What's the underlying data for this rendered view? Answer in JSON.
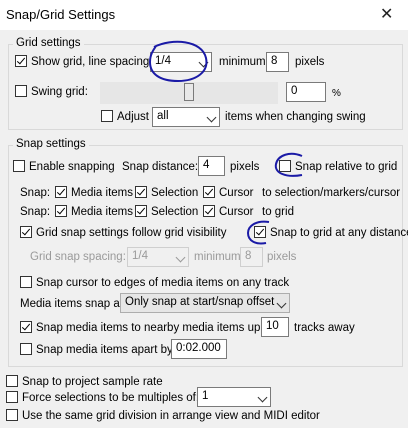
{
  "window": {
    "title": "Snap/Grid Settings",
    "close_glyph": "✕"
  },
  "grid": {
    "label": "Grid settings",
    "show_grid_label": "Show grid, line spacing:",
    "show_grid_checked": true,
    "line_spacing": "1/4",
    "minimum_label": "minimum:",
    "minimum_value": "8",
    "pixels_label": "pixels",
    "swing_label": "Swing grid:",
    "swing_checked": false,
    "swing_value": "0",
    "swing_level": 0.5,
    "percent_label": "%",
    "adjust_label": "Adjust",
    "adjust_checked": false,
    "adjust_value": "all",
    "adjust_suffix": "items when changing swing"
  },
  "snap": {
    "label": "Snap settings",
    "enable_label": "Enable snapping",
    "enable_checked": false,
    "distance_label": "Snap distance:",
    "distance_value": "4",
    "distance_unit": "pixels",
    "relative_label": "Snap relative to grid",
    "relative_checked": false,
    "row1_label": "Snap:",
    "row2_label": "Snap:",
    "media_items": "Media items",
    "selection": "Selection",
    "cursor": "Cursor",
    "row1_suffix": "to selection/markers/cursor",
    "row2_suffix": "to grid",
    "follow_label": "Grid snap settings follow grid visibility",
    "follow_checked": true,
    "any_distance_label": "Snap to grid at any distance",
    "any_distance_checked": true,
    "grid_spacing_label": "Grid snap spacing:",
    "grid_spacing_value": "1/4",
    "grid_min_label": "minimum:",
    "grid_min_value": "8",
    "grid_min_unit": "pixels",
    "cursor_edges_label": "Snap cursor to edges of media items on any track",
    "cursor_edges_checked": false,
    "media_snap_label": "Media items snap at:",
    "media_snap_value": "Only snap at start/snap offset",
    "nearby_label": "Snap media items to nearby media items up to:",
    "nearby_checked": true,
    "nearby_value": "10",
    "nearby_unit": "tracks away",
    "apart_label": "Snap media items apart by:",
    "apart_checked": false,
    "apart_value": "0:02.000"
  },
  "bottom": {
    "sample_rate_label": "Snap to project sample rate",
    "multiples_label": "Force selections to be multiples of:",
    "multiples_value": "1",
    "same_grid_label": "Use the same grid division in arrange view and MIDI editor"
  },
  "annotation_color": "#1a1aa6"
}
